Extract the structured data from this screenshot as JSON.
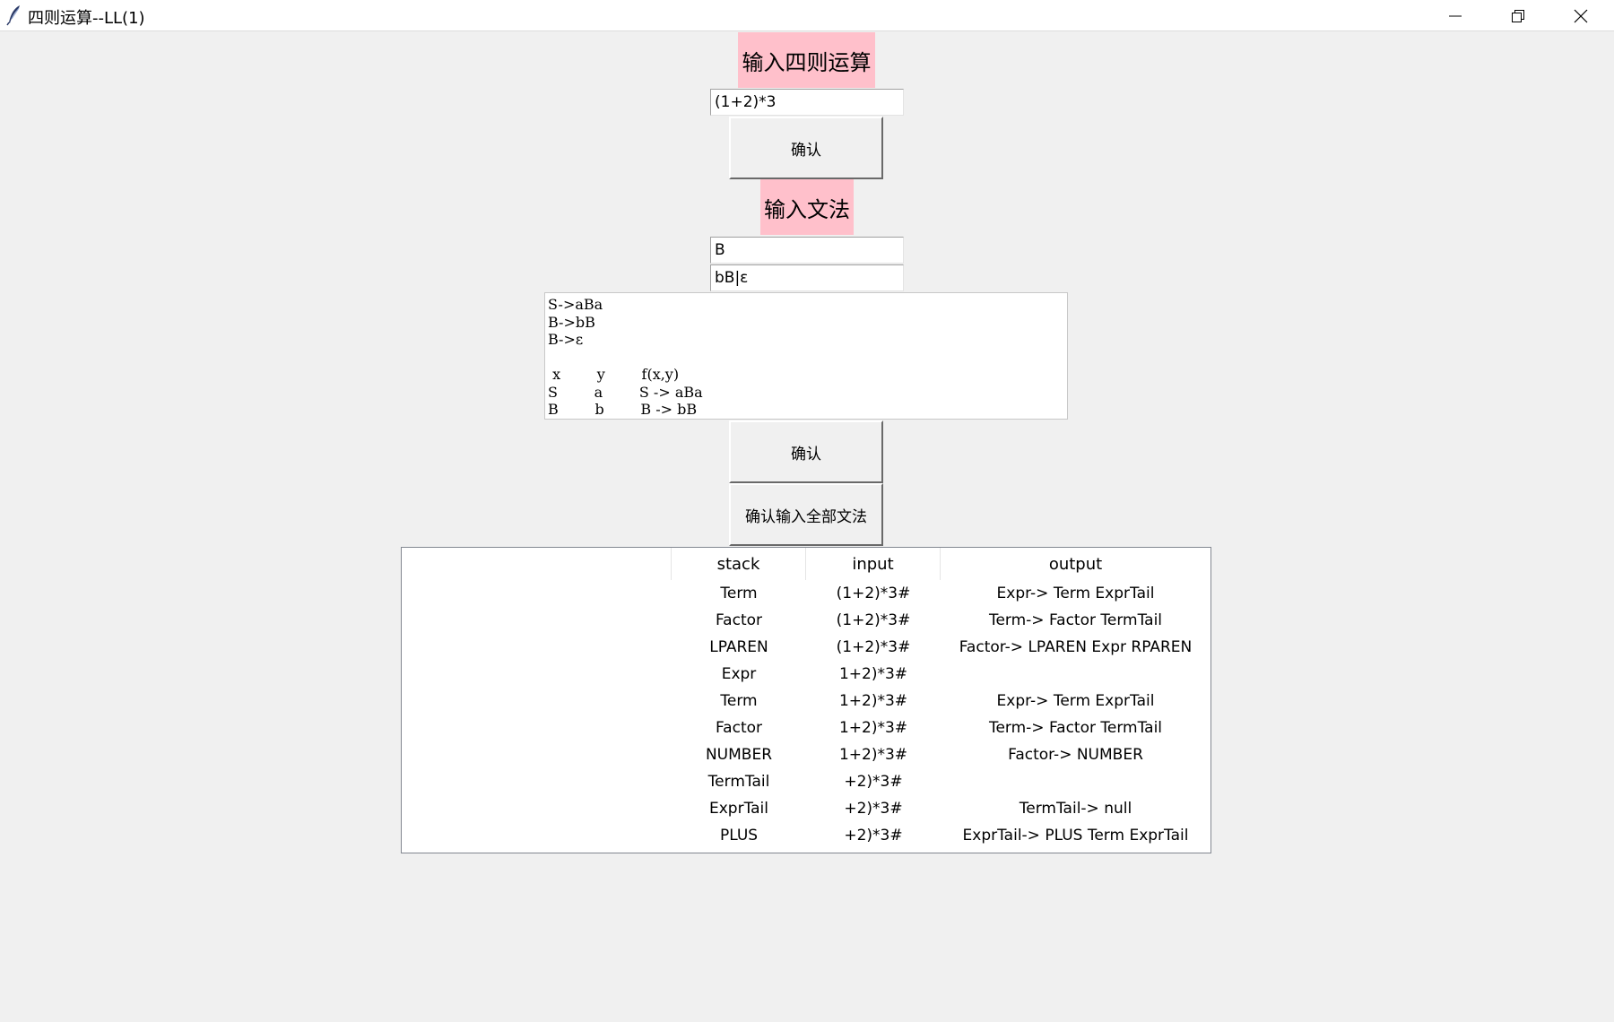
{
  "window": {
    "title": "四则运算--LL(1)"
  },
  "arith": {
    "label": "输入四则运算",
    "input_value": "(1+2)*3",
    "confirm_label": "确认"
  },
  "grammar": {
    "label": "输入文法",
    "left_value": "B",
    "right_value": "bB|ε",
    "output_text": "S->aBa\nB->bB\nB->ε\n\n x        y        f(x,y)\nS        a        S -> aBa\nB        b        B -> bB",
    "confirm_label": "确认",
    "confirm_all_label": "确认输入全部文法"
  },
  "table": {
    "columns": [
      "",
      "stack",
      "input",
      "output"
    ],
    "rows": [
      [
        "",
        "Term",
        "(1+2)*3#",
        "Expr-> Term ExprTail"
      ],
      [
        "",
        "Factor",
        "(1+2)*3#",
        "Term-> Factor TermTail"
      ],
      [
        "",
        "LPAREN",
        "(1+2)*3#",
        "Factor-> LPAREN Expr RPAREN"
      ],
      [
        "",
        "Expr",
        "1+2)*3#",
        ""
      ],
      [
        "",
        "Term",
        "1+2)*3#",
        "Expr-> Term ExprTail"
      ],
      [
        "",
        "Factor",
        "1+2)*3#",
        "Term-> Factor TermTail"
      ],
      [
        "",
        "NUMBER",
        "1+2)*3#",
        "Factor-> NUMBER"
      ],
      [
        "",
        "TermTail",
        "+2)*3#",
        ""
      ],
      [
        "",
        "ExprTail",
        "+2)*3#",
        "TermTail-> null"
      ],
      [
        "",
        "PLUS",
        "+2)*3#",
        "ExprTail-> PLUS Term ExprTail"
      ]
    ]
  },
  "icons": {
    "app": "feather-icon",
    "minimize": "minimize-icon",
    "maximize": "restore-icon",
    "close": "close-icon"
  },
  "colors": {
    "label_bg": "#ffc0cb",
    "window_bg": "#f0f0f0"
  }
}
